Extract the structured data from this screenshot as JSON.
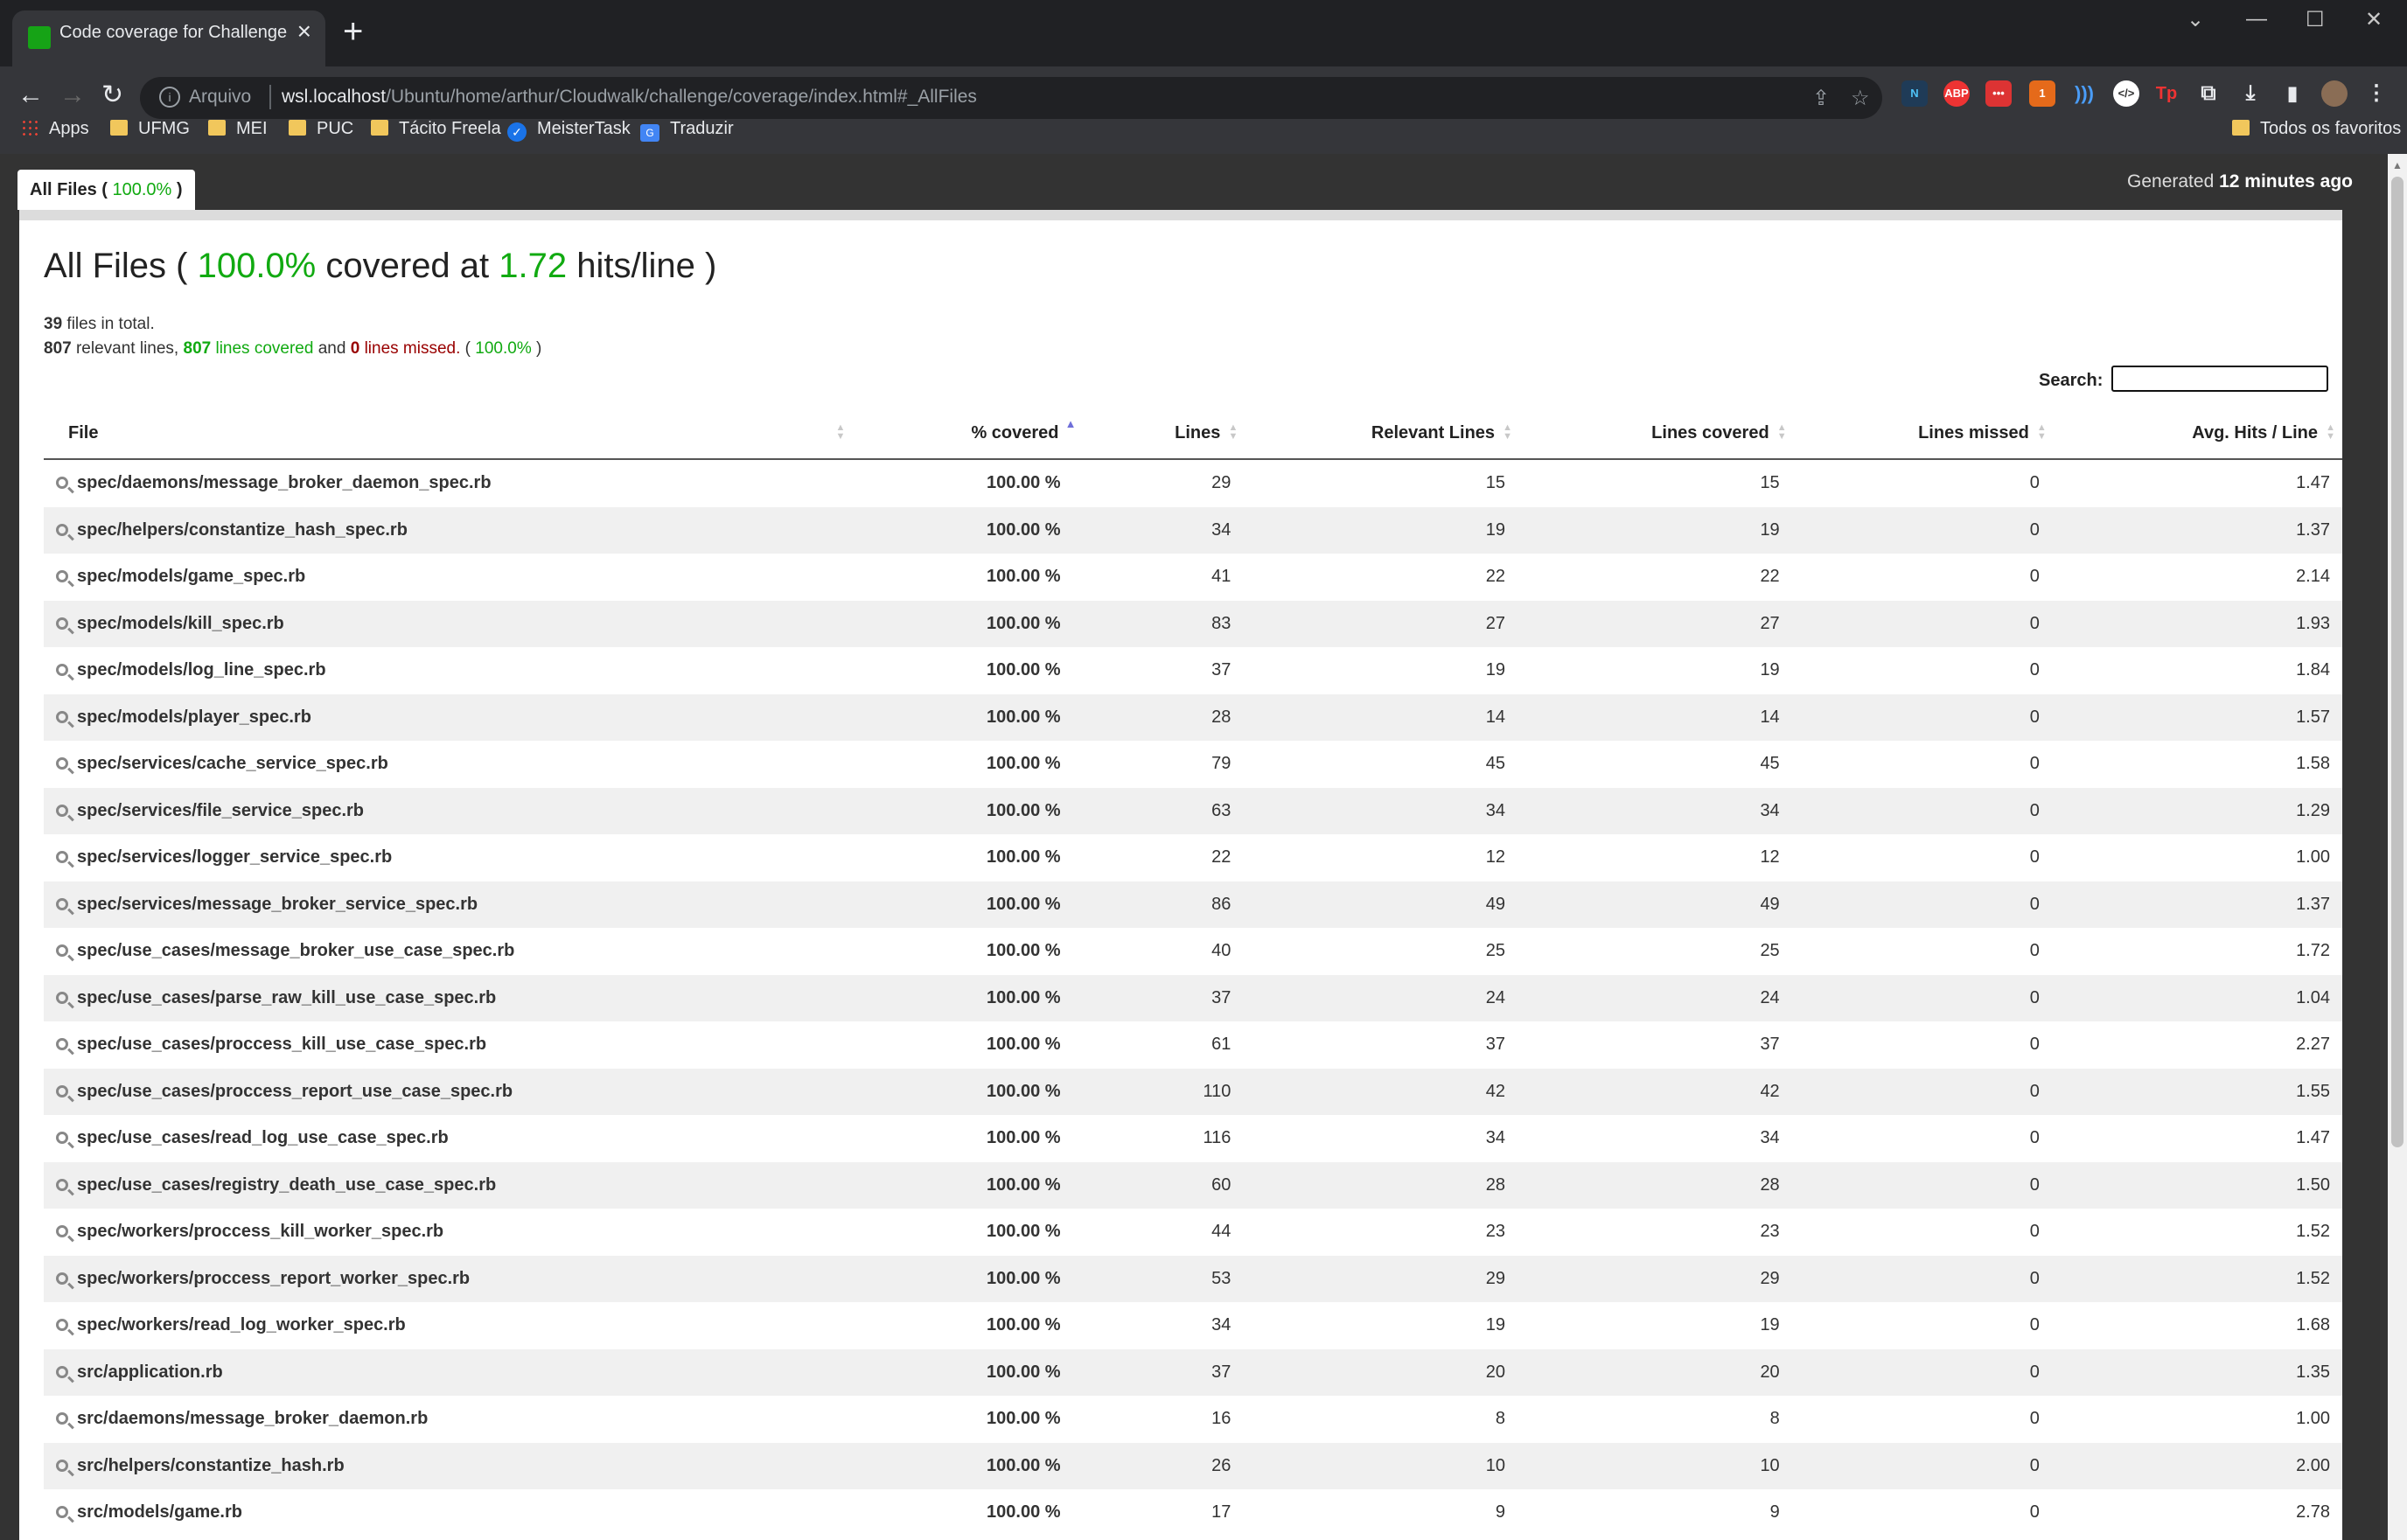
{
  "browser": {
    "tab_title": "Code coverage for Challenge",
    "url_prefix": "Arquivo",
    "url_host": "wsl.localhost",
    "url_path": "/Ubuntu/home/arthur/Cloudwalk/challenge/coverage/index.html#_AllFiles",
    "bookmarks": [
      "Apps",
      "UFMG",
      "MEI",
      "PUC",
      "Tácito Freela",
      "MeisterTask",
      "Traduzir"
    ],
    "all_bookmarks": "Todos os favoritos"
  },
  "page": {
    "tab_label": "All Files (",
    "tab_percent": "100.0%",
    "tab_close": ")",
    "generated_label": "Generated",
    "generated_time": "12 minutes ago",
    "title_prefix": "All Files (",
    "title_percent": "100.0%",
    "title_mid": "covered at",
    "title_hits": "1.72",
    "title_suffix": "hits/line )",
    "files_count": "39",
    "files_text": "files in total.",
    "relevant_lines": "807",
    "relevant_text": "relevant lines,",
    "covered_lines": "807",
    "covered_text": "lines covered",
    "and_text": "and",
    "missed_lines": "0",
    "missed_text": "lines missed.",
    "paren_open": "(",
    "summary_percent": "100.0%",
    "paren_close": ")",
    "search_label": "Search:",
    "search_value": ""
  },
  "table": {
    "headers": [
      "File",
      "% covered",
      "Lines",
      "Relevant Lines",
      "Lines covered",
      "Lines missed",
      "Avg. Hits / Line"
    ],
    "rows": [
      [
        "spec/daemons/message_broker_daemon_spec.rb",
        "100.00 %",
        "29",
        "15",
        "15",
        "0",
        "1.47"
      ],
      [
        "spec/helpers/constantize_hash_spec.rb",
        "100.00 %",
        "34",
        "19",
        "19",
        "0",
        "1.37"
      ],
      [
        "spec/models/game_spec.rb",
        "100.00 %",
        "41",
        "22",
        "22",
        "0",
        "2.14"
      ],
      [
        "spec/models/kill_spec.rb",
        "100.00 %",
        "83",
        "27",
        "27",
        "0",
        "1.93"
      ],
      [
        "spec/models/log_line_spec.rb",
        "100.00 %",
        "37",
        "19",
        "19",
        "0",
        "1.84"
      ],
      [
        "spec/models/player_spec.rb",
        "100.00 %",
        "28",
        "14",
        "14",
        "0",
        "1.57"
      ],
      [
        "spec/services/cache_service_spec.rb",
        "100.00 %",
        "79",
        "45",
        "45",
        "0",
        "1.58"
      ],
      [
        "spec/services/file_service_spec.rb",
        "100.00 %",
        "63",
        "34",
        "34",
        "0",
        "1.29"
      ],
      [
        "spec/services/logger_service_spec.rb",
        "100.00 %",
        "22",
        "12",
        "12",
        "0",
        "1.00"
      ],
      [
        "spec/services/message_broker_service_spec.rb",
        "100.00 %",
        "86",
        "49",
        "49",
        "0",
        "1.37"
      ],
      [
        "spec/use_cases/message_broker_use_case_spec.rb",
        "100.00 %",
        "40",
        "25",
        "25",
        "0",
        "1.72"
      ],
      [
        "spec/use_cases/parse_raw_kill_use_case_spec.rb",
        "100.00 %",
        "37",
        "24",
        "24",
        "0",
        "1.04"
      ],
      [
        "spec/use_cases/proccess_kill_use_case_spec.rb",
        "100.00 %",
        "61",
        "37",
        "37",
        "0",
        "2.27"
      ],
      [
        "spec/use_cases/proccess_report_use_case_spec.rb",
        "100.00 %",
        "110",
        "42",
        "42",
        "0",
        "1.55"
      ],
      [
        "spec/use_cases/read_log_use_case_spec.rb",
        "100.00 %",
        "116",
        "34",
        "34",
        "0",
        "1.47"
      ],
      [
        "spec/use_cases/registry_death_use_case_spec.rb",
        "100.00 %",
        "60",
        "28",
        "28",
        "0",
        "1.50"
      ],
      [
        "spec/workers/proccess_kill_worker_spec.rb",
        "100.00 %",
        "44",
        "23",
        "23",
        "0",
        "1.52"
      ],
      [
        "spec/workers/proccess_report_worker_spec.rb",
        "100.00 %",
        "53",
        "29",
        "29",
        "0",
        "1.52"
      ],
      [
        "spec/workers/read_log_worker_spec.rb",
        "100.00 %",
        "34",
        "19",
        "19",
        "0",
        "1.68"
      ],
      [
        "src/application.rb",
        "100.00 %",
        "37",
        "20",
        "20",
        "0",
        "1.35"
      ],
      [
        "src/daemons/message_broker_daemon.rb",
        "100.00 %",
        "16",
        "8",
        "8",
        "0",
        "1.00"
      ],
      [
        "src/helpers/constantize_hash.rb",
        "100.00 %",
        "26",
        "10",
        "10",
        "0",
        "2.00"
      ],
      [
        "src/models/game.rb",
        "100.00 %",
        "17",
        "9",
        "9",
        "0",
        "2.78"
      ]
    ]
  },
  "colors": {
    "green": "#11aa11",
    "red": "#990000",
    "header_bg": "#333333"
  }
}
